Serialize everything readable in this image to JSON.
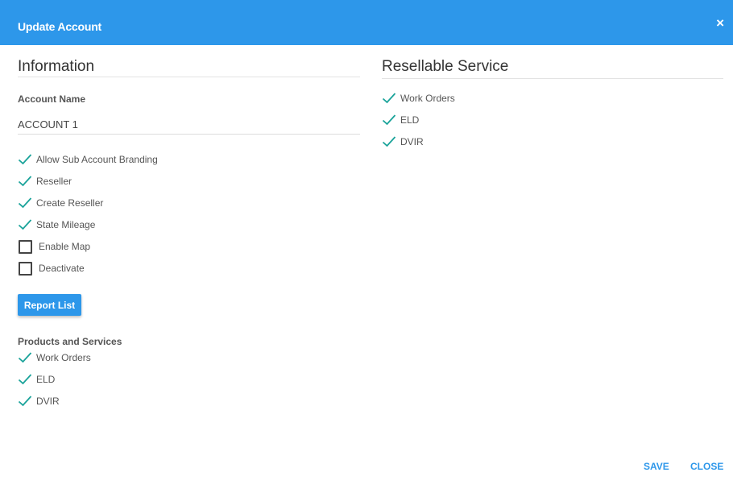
{
  "dialog": {
    "title": "Update Account",
    "close_glyph": "×"
  },
  "information": {
    "title": "Information",
    "account_name_label": "Account Name",
    "account_name_value": "ACCOUNT 1",
    "options": [
      {
        "label": "Allow Sub Account Branding",
        "checked": true
      },
      {
        "label": "Reseller",
        "checked": true
      },
      {
        "label": "Create Reseller",
        "checked": true
      },
      {
        "label": "State Mileage",
        "checked": true
      },
      {
        "label": "Enable Map",
        "checked": false
      },
      {
        "label": "Deactivate",
        "checked": false
      }
    ],
    "report_list_label": "Report List",
    "products_label": "Products and Services",
    "products": [
      {
        "label": "Work Orders",
        "checked": true
      },
      {
        "label": "ELD",
        "checked": true
      },
      {
        "label": "DVIR",
        "checked": true
      }
    ]
  },
  "resellable": {
    "title": "Resellable Service",
    "items": [
      {
        "label": "Work Orders",
        "checked": true
      },
      {
        "label": "ELD",
        "checked": true
      },
      {
        "label": "DVIR",
        "checked": true
      }
    ]
  },
  "footer": {
    "save_label": "SAVE",
    "close_label": "CLOSE"
  },
  "colors": {
    "accent": "#2d97ea",
    "check": "#1aa39a"
  }
}
